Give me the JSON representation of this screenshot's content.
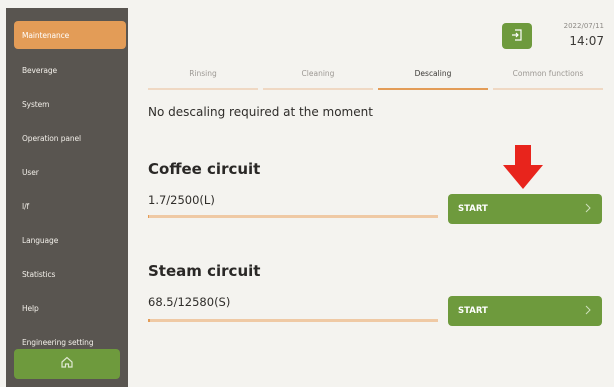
{
  "sidebar": {
    "items": [
      {
        "label": "Maintenance",
        "active": true
      },
      {
        "label": "Beverage",
        "active": false
      },
      {
        "label": "System",
        "active": false
      },
      {
        "label": "Operation panel",
        "active": false
      },
      {
        "label": "User",
        "active": false
      },
      {
        "label": "I/f",
        "active": false
      },
      {
        "label": "Language",
        "active": false
      },
      {
        "label": "Statistics",
        "active": false
      },
      {
        "label": "Help",
        "active": false
      },
      {
        "label": "Engineering setting",
        "active": false
      }
    ],
    "home_icon": "home-icon"
  },
  "header": {
    "date": "2022/07/11",
    "time": "14:07",
    "exit_icon": "exit-icon"
  },
  "tabs": [
    {
      "label": "Rinsing",
      "active": false
    },
    {
      "label": "Cleaning",
      "active": false
    },
    {
      "label": "Descaling",
      "active": true
    },
    {
      "label": "Common functions",
      "active": false
    }
  ],
  "notice": "No descaling required at the moment",
  "circuits": [
    {
      "title": "Coffee circuit",
      "value": "1.7/2500(L)",
      "progress": 0.0007,
      "button": "START"
    },
    {
      "title": "Steam circuit",
      "value": "68.5/12580(S)",
      "progress": 0.0054,
      "button": "START"
    }
  ],
  "colors": {
    "accent": "#e39c57",
    "green": "#6e9a3d",
    "sidebar": "#595550",
    "arrow": "#e8241c"
  }
}
